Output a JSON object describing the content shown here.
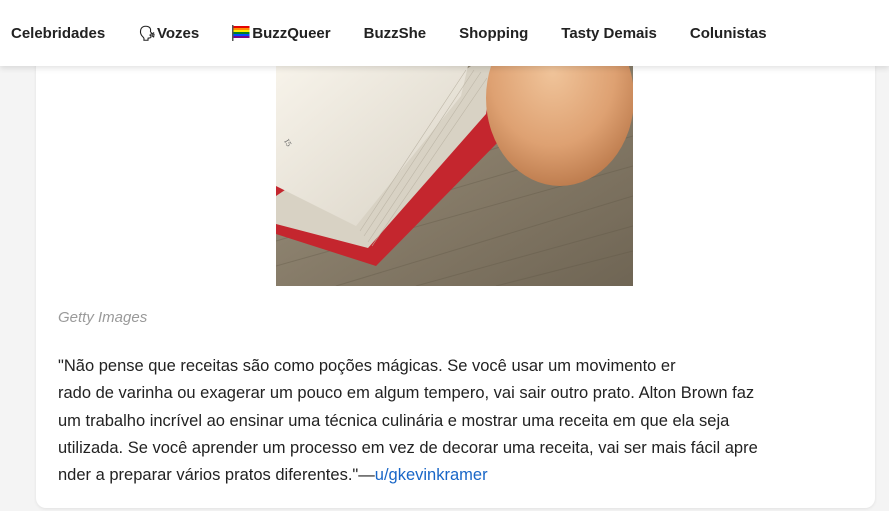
{
  "nav": {
    "items": [
      {
        "label": "Celebridades"
      },
      {
        "label": "Vozes",
        "icon": "speaking-head-icon"
      },
      {
        "label": "BuzzQueer",
        "icon": "rainbow-flag-icon"
      },
      {
        "label": "BuzzShe"
      },
      {
        "label": "Shopping"
      },
      {
        "label": "Tasty Demais"
      },
      {
        "label": "Colunistas"
      }
    ]
  },
  "article": {
    "image": {
      "alt": "",
      "colors": {
        "wood": "#8a7f6d",
        "book_cover": "#c4262e",
        "egg": "#e0a978"
      }
    },
    "caption": "Getty Images",
    "quote_lines": [
      "\"Não pense que receitas são como poções mágicas. Se você usar um movimento er",
      "rado de varinha ou exagerar um pouco em algum tempero, vai sair outro prato. Alton Brown faz",
      "um trabalho incrível ao ensinar uma técnica culinária e mostrar uma receita em que ela seja",
      "utilizada. Se você aprender um processo em vez de decorar uma receita, vai ser mais fácil apre",
      "nder a preparar vários pratos diferentes.\"—"
    ],
    "author_link": "u/gkevinkramer",
    "link_color": "#1866c7"
  }
}
